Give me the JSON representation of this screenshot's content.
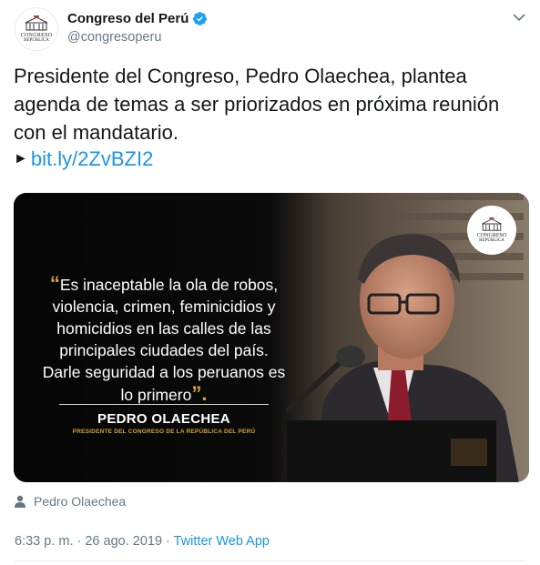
{
  "account": {
    "display_name": "Congreso del Perú",
    "handle": "@congresoperu",
    "avatar_text_1": "CONGRESO",
    "avatar_text_2": "REPÚBLICA",
    "verified": true
  },
  "tweet": {
    "text": "Presidente del Congreso, Pedro Olaechea, plantea agenda de temas a ser priorizados en próxima reunión con el mandatario.",
    "link_arrow": "►",
    "link": "bit.ly/2ZvBZI2"
  },
  "media": {
    "quote_open": "“",
    "quote_text": "Es inaceptable la ola de robos, violencia, crimen, feminicidios y homicidios en las calles de las principales ciudades del país. Darle seguridad a los peruanos es lo primero",
    "quote_close": "”.",
    "speaker_name": "PEDRO OLAECHEA",
    "speaker_role": "PRESIDENTE DEL CONGRESO DE LA REPÚBLICA DEL PERÚ",
    "logo_text_1": "CONGRESO",
    "logo_text_2": "REPÚBLICA"
  },
  "tagged": {
    "name": "Pedro Olaechea"
  },
  "meta": {
    "timestamp": "6:33 p. m. · 26 ago. 2019 · ",
    "source": "Twitter Web App"
  },
  "colors": {
    "link": "#1b95e0",
    "secondary_text": "#657786",
    "accent_gold": "#d4a23a"
  }
}
